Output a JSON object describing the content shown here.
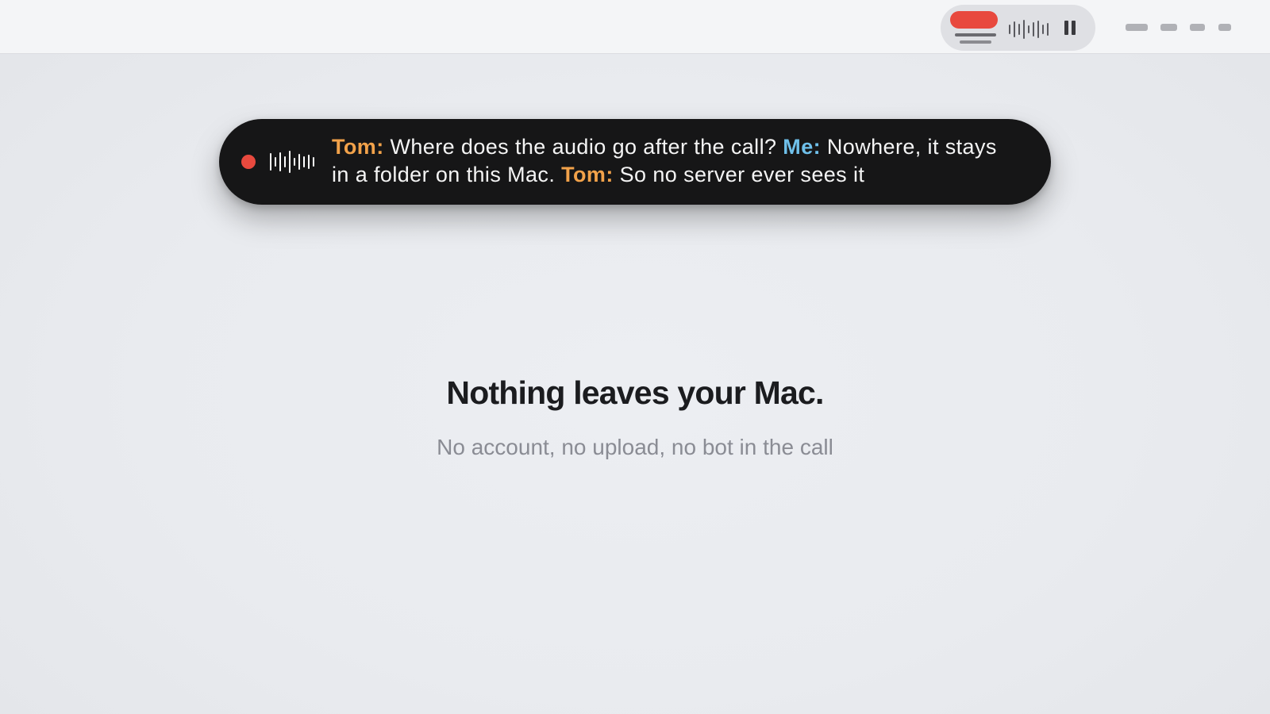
{
  "menubar": {
    "widget": {
      "record_icon": "record-pill-icon",
      "waveform_icon": "waveform-icon",
      "pause_icon": "pause-icon"
    },
    "menu_extras": [
      "menu-extra-1",
      "menu-extra-2",
      "menu-extra-3",
      "menu-extra-4"
    ]
  },
  "caption": {
    "recording_indicator": "recording-dot-icon",
    "waveform_icon": "waveform-icon",
    "segments": [
      {
        "speaker": "Tom:",
        "text": " Where does the audio go after the call? "
      },
      {
        "speaker": "Me:",
        "text": " Nowhere, it stays in a folder on this Mac. "
      },
      {
        "speaker": "Tom:",
        "text": " So no server ever sees it"
      }
    ]
  },
  "main": {
    "headline": "Nothing leaves your Mac.",
    "subheadline": "No account, no upload, no bot in the call"
  },
  "colors": {
    "record_red": "#e8493e",
    "speaker_them": "#f2a24a",
    "speaker_me": "#6fc0ea",
    "caption_bg": "#161617",
    "headline": "#1b1c1f",
    "subheadline": "#8a8c94"
  }
}
